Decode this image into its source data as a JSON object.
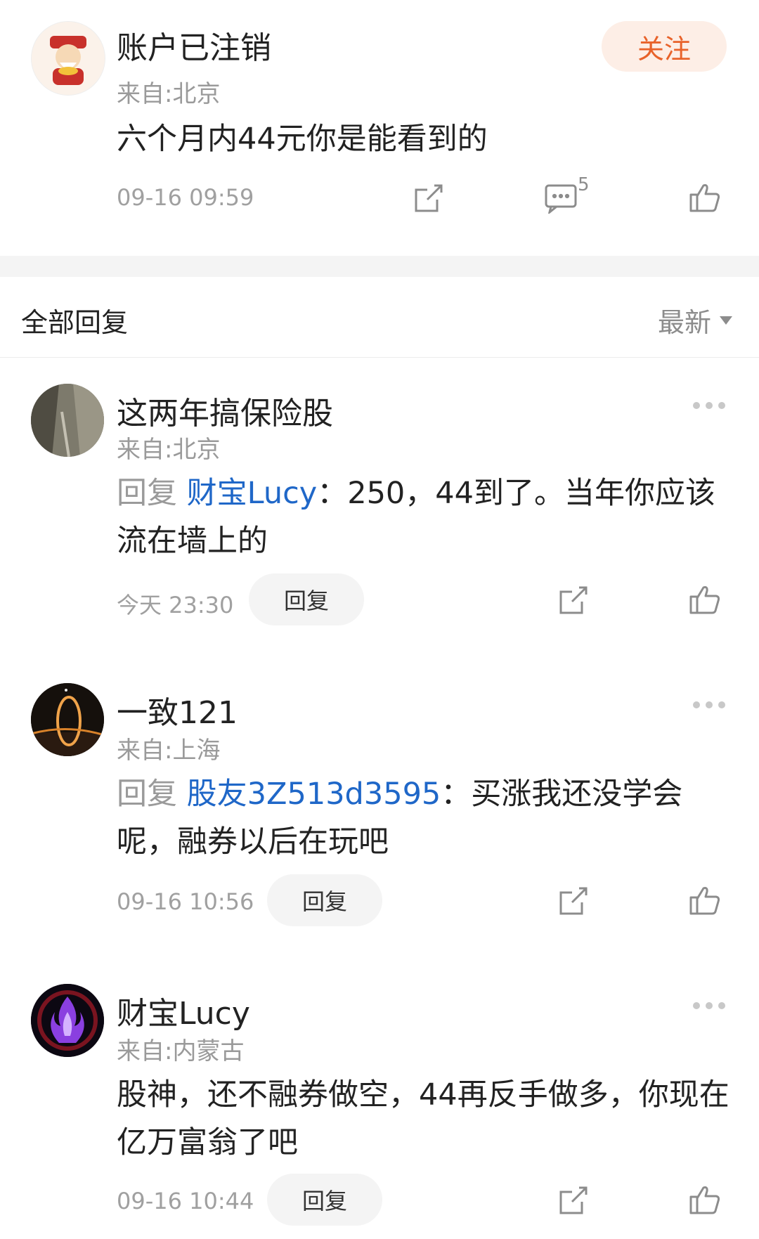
{
  "post": {
    "author": "账户已注销",
    "location": "来自:北京",
    "follow_label": "关注",
    "text": "六个月内44元你是能看到的",
    "time": "09-16 09:59",
    "comment_count": "5"
  },
  "replies_header": {
    "title": "全部回复",
    "sort_label": "最新"
  },
  "replies": [
    {
      "name": "这两年搞保险股",
      "location": "来自:北京",
      "prefix": "回复",
      "mention": "财宝Lucy",
      "text": "：250，44到了。当年你应该流在墙上的",
      "time": "今天 23:30",
      "reply_label": "回复"
    },
    {
      "name": "一致121",
      "location": "来自:上海",
      "prefix": "回复",
      "mention": "股友3Z513d3595",
      "text": "：买涨我还没学会呢，融券以后在玩吧",
      "time": "09-16 10:56",
      "reply_label": "回复"
    },
    {
      "name": "财宝Lucy",
      "location": "来自:内蒙古",
      "prefix": "",
      "mention": "",
      "text": "股神，还不融券做空，44再反手做多，你现在亿万富翁了吧",
      "time": "09-16 10:44",
      "reply_label": "回复"
    }
  ],
  "colors": {
    "mention": "#1f67c8",
    "follow_text": "#e8622a",
    "follow_bg": "#fdeee6"
  }
}
